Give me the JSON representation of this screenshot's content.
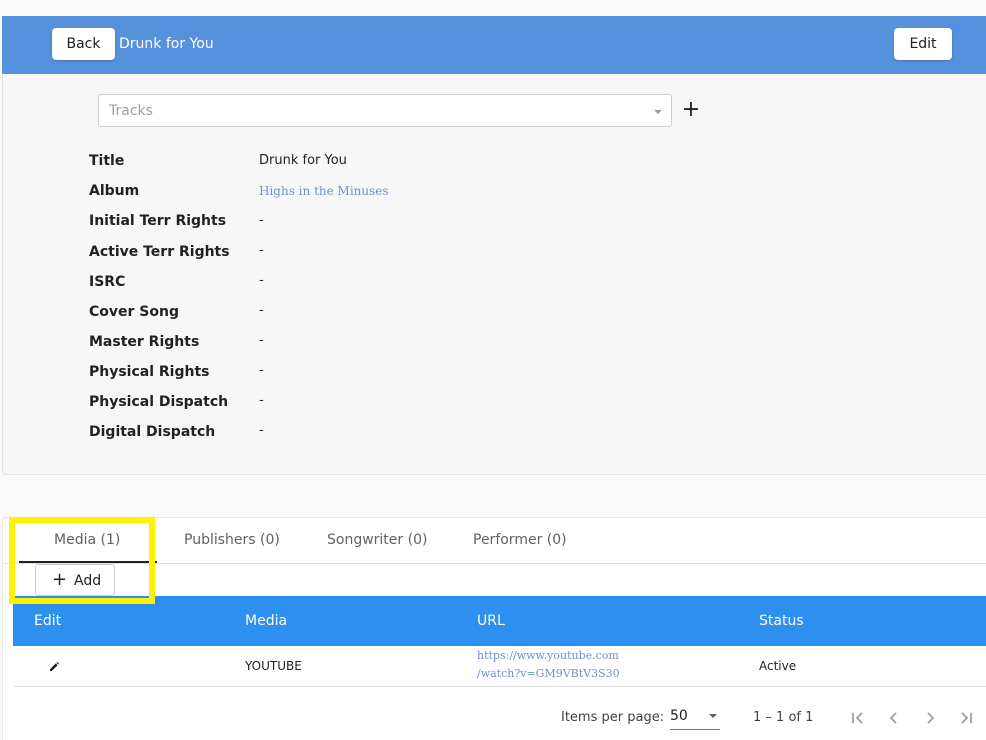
{
  "header": {
    "back_label": "Back",
    "title": "Drunk for You",
    "edit_label": "Edit",
    "bg_color": "#5591dc"
  },
  "tracks": {
    "placeholder": "Tracks",
    "add_icon": "plus-icon"
  },
  "details": [
    {
      "label": "Title",
      "value": "Drunk for You"
    },
    {
      "label": "Album",
      "value": "Highs in the Minuses"
    },
    {
      "label": "Initial Terr Rights",
      "value": "-"
    },
    {
      "label": "Active Terr Rights",
      "value": "-"
    },
    {
      "label": "ISRC",
      "value": "-"
    },
    {
      "label": "Cover Song",
      "value": "-"
    },
    {
      "label": "Master Rights",
      "value": "-"
    },
    {
      "label": "Physical Rights",
      "value": "-"
    },
    {
      "label": "Physical Dispatch",
      "value": "-"
    },
    {
      "label": "Digital Dispatch",
      "value": "-"
    }
  ],
  "tabs": [
    {
      "label": "Media (1)",
      "active": true
    },
    {
      "label": "Publishers (0)",
      "active": false
    },
    {
      "label": "Songwriter (0)",
      "active": false
    },
    {
      "label": "Performer (0)",
      "active": false
    }
  ],
  "add_button": {
    "label": "Add",
    "icon": "plus-icon"
  },
  "table": {
    "headers": [
      "Edit",
      "Media",
      "URL",
      "Status"
    ],
    "header_color": "#2d8ff0",
    "rows": [
      {
        "edit_icon": "pencil-icon",
        "media": "YOUTUBE",
        "url_line1": "https://www.youtube.com",
        "url_line2": "/watch?v=GM9VBtV3S30",
        "status": "Active"
      }
    ]
  },
  "paginator": {
    "items_per_page_label": "Items per page:",
    "items_per_page_value": "50",
    "range_label": "1 – 1 of 1"
  },
  "highlight_color": "#fff200"
}
